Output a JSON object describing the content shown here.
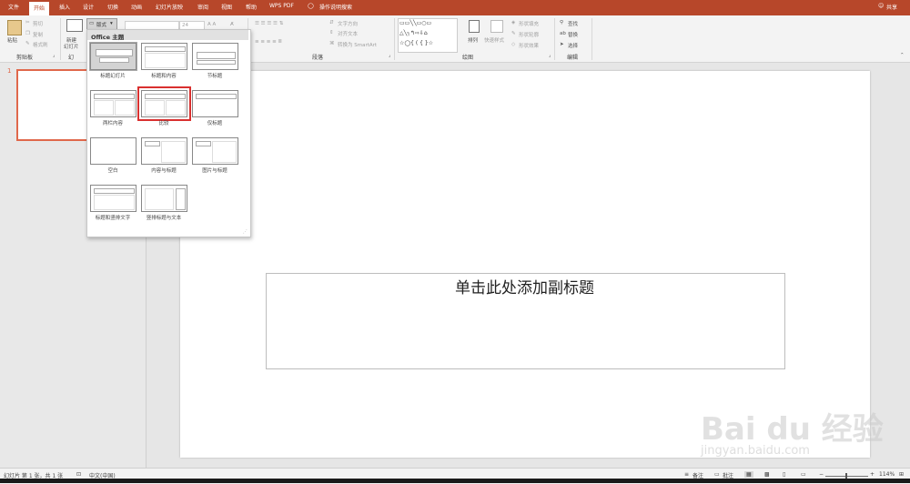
{
  "tabs": [
    {
      "label": "文件"
    },
    {
      "label": "开始",
      "active": true
    },
    {
      "label": "插入"
    },
    {
      "label": "设计"
    },
    {
      "label": "切换"
    },
    {
      "label": "动画"
    },
    {
      "label": "幻灯片放映"
    },
    {
      "label": "审阅"
    },
    {
      "label": "视图"
    },
    {
      "label": "帮助"
    },
    {
      "label": "WPS PDF"
    }
  ],
  "tell_me": "操作说明搜索",
  "share": "共享",
  "ribbon": {
    "clipboard": {
      "paste": "粘贴",
      "cut": "剪切",
      "copy": "复制",
      "format_painter": "格式刷",
      "group": "剪贴板"
    },
    "slides": {
      "new_slide": "新建",
      "new_slide_line2": "幻灯片",
      "layout": "版式",
      "group": "幻"
    },
    "font": {
      "size": "24"
    },
    "paragraph": {
      "text_direction": "文字方向",
      "align_text": "对齐文本",
      "smartart": "转换为 SmartArt",
      "group": "段落"
    },
    "drawing": {
      "arrange": "排列",
      "quick_styles": "快速样式",
      "shape_fill": "形状填充",
      "shape_outline": "形状轮廓",
      "shape_effects": "形状效果",
      "group": "绘图"
    },
    "editing": {
      "find": "查找",
      "replace": "替换",
      "select": "选择",
      "group": "编辑"
    }
  },
  "layout_menu": {
    "header": "Office 主题",
    "layouts": [
      {
        "label": "标题幻灯片",
        "selected": true
      },
      {
        "label": "标题和内容"
      },
      {
        "label": "节标题"
      },
      {
        "label": "两栏内容"
      },
      {
        "label": "比较",
        "highlighted": true
      },
      {
        "label": "仅标题"
      },
      {
        "label": "空白"
      },
      {
        "label": "内容与标题"
      },
      {
        "label": "图片与标题"
      },
      {
        "label": "标题和竖排文字"
      },
      {
        "label": "竖排标题与文本"
      }
    ]
  },
  "slide_panel": {
    "number": "1"
  },
  "slide": {
    "subtitle_placeholder": "单击此处添加副标题"
  },
  "status": {
    "slide_info": "幻灯片 第 1 张，共 1 张",
    "language": "中文(中国)",
    "notes": "备注",
    "comments": "批注",
    "zoom": "114%"
  },
  "watermark": {
    "brand": "Bai du 经验",
    "url": "jingyan.baidu.com"
  },
  "colors": {
    "accent": "#b7472a",
    "thumb_border": "#e0684b",
    "highlight": "#d9302f"
  }
}
